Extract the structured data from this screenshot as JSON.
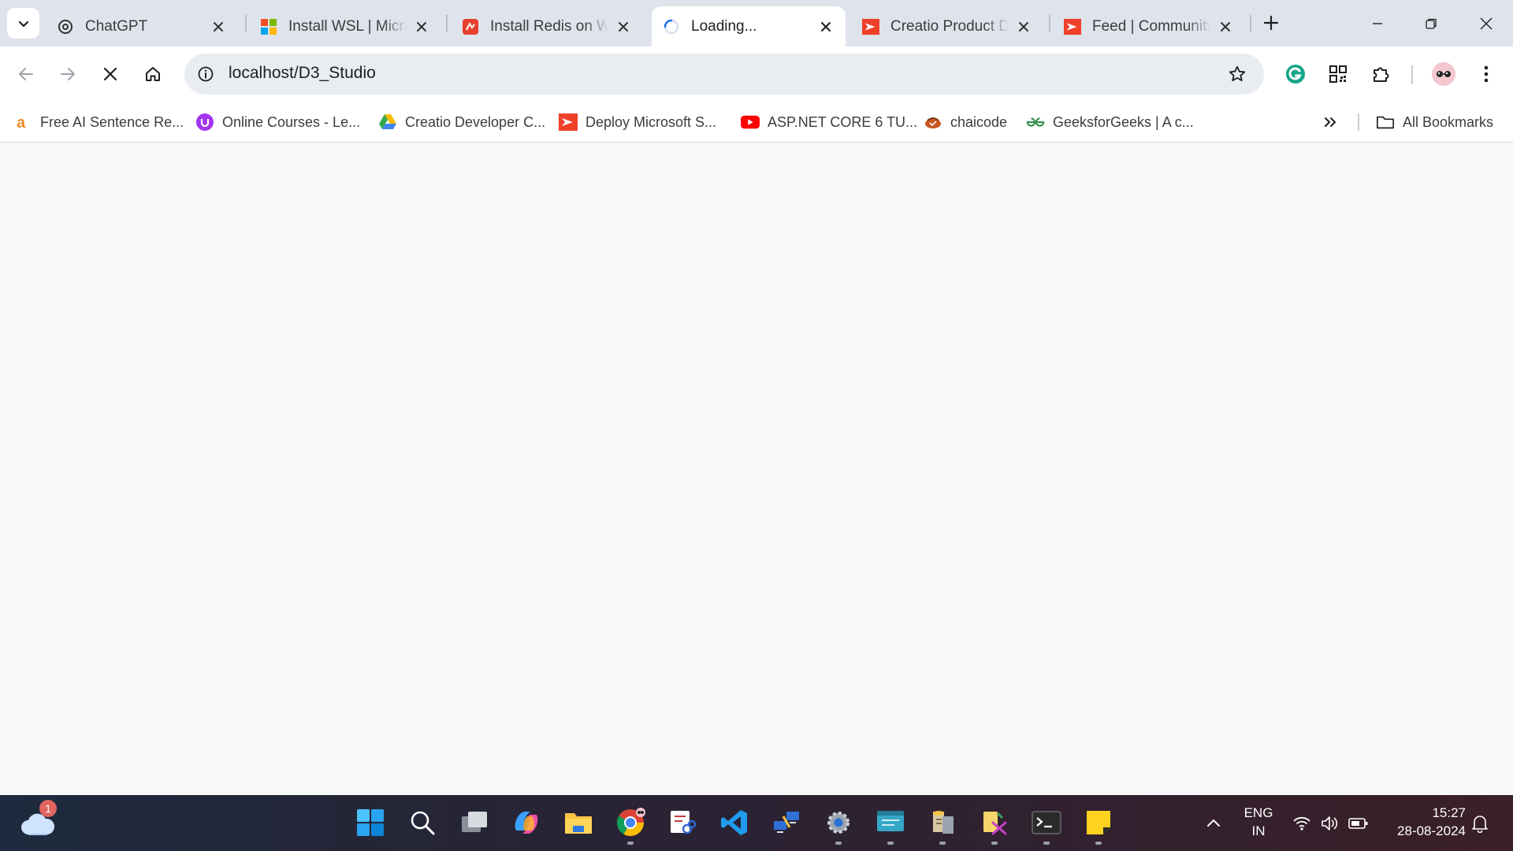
{
  "tabs": [
    {
      "title": "ChatGPT",
      "favicon": "openai-icon",
      "active": false
    },
    {
      "title": "Install WSL | Microsoft Learn",
      "favicon": "microsoft-icon",
      "active": false
    },
    {
      "title": "Install Redis on Windows",
      "favicon": "redis-icon",
      "active": false
    },
    {
      "title": "Loading...",
      "favicon": "loading-spinner-icon",
      "active": true
    },
    {
      "title": "Creatio Product Documentation",
      "favicon": "creatio-icon",
      "active": false
    },
    {
      "title": "Feed | Community",
      "favicon": "creatio-icon",
      "active": false
    }
  ],
  "toolbar": {
    "url": "localhost/D3_Studio",
    "extensions": [
      "grammarly-icon",
      "qr-code-icon",
      "extensions-puzzle-icon"
    ]
  },
  "bookmarks": [
    {
      "label": "Free AI Sentence Re...",
      "icon": "amazon-a-icon"
    },
    {
      "label": "Online Courses - Le...",
      "icon": "udemy-icon"
    },
    {
      "label": "Creatio Developer C...",
      "icon": "google-drive-icon"
    },
    {
      "label": "Deploy Microsoft S...",
      "icon": "creatio-icon"
    },
    {
      "label": "ASP.NET CORE 6 TU...",
      "icon": "youtube-icon"
    },
    {
      "label": "chaicode",
      "icon": "chaicode-icon"
    },
    {
      "label": "GeeksforGeeks | A c...",
      "icon": "geeksforgeeks-icon"
    }
  ],
  "all_bookmarks_label": "All Bookmarks",
  "taskbar": {
    "weather_badge": "1",
    "language_top": "ENG",
    "language_bottom": "IN",
    "time": "15:27",
    "date": "28-08-2024"
  },
  "colors": {
    "accent_blue": "#1a73e8",
    "creatio_red": "#f0402a",
    "tabstrip_bg": "#dfe3eb",
    "page_bg": "#f8f8f8"
  }
}
